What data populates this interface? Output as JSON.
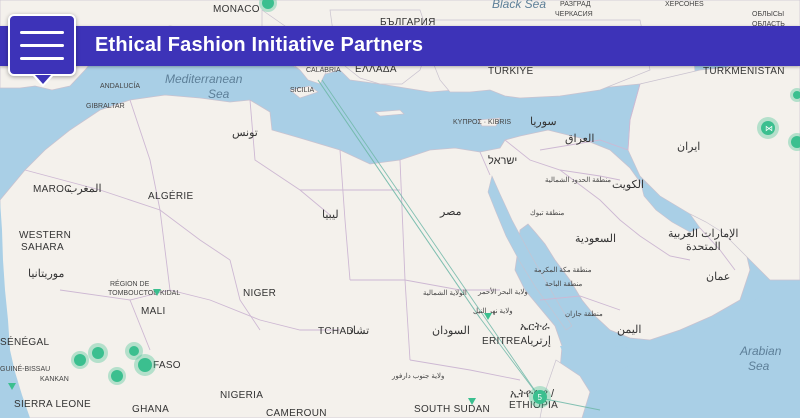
{
  "header": {
    "title": "Ethical Fashion Initiative Partners"
  },
  "map": {
    "land_color": "#f4f1ec",
    "water_color": "#a9cfe6",
    "marker_color": "#3bbf8f",
    "route_color": "#6fb8a8",
    "seas": {
      "black_sea": "Black Sea",
      "mediterranean": "Mediterranean",
      "sea": "Sea",
      "arabian": "Arabian",
      "sea2": "Sea"
    },
    "countries": {
      "monaco": "MONACO",
      "bulgaria": "БЪЛГАРИЯ",
      "greece": "ΕΛΛΑΔΑ",
      "turkey": "TÜRKİYE",
      "turkmenistan": "TURKMENISTAN",
      "gibraltar": "GIBRALTAR",
      "andalucia": "ANDALUCÍA",
      "sicilia": "SICILIA",
      "calabria": "CALABRIA",
      "tunisia": "تونس",
      "cyprus": "ΚΥΠΡΟΣ · KIBRIS",
      "syria": "سوريا",
      "iraq": "العراق",
      "iran": "ایران",
      "israel": "ישראל",
      "morocco_fr": "MAROC",
      "morocco_ar": "المغرب",
      "algeria": "ALGÉRIE",
      "libya": "ليبيا",
      "egypt": "مصر",
      "kuwait": "الكويت",
      "saudi": "السعودية",
      "uae_1": "الإمارات العربية",
      "uae_2": "المتحدة",
      "oman": "عمان",
      "western_sahara_1": "WESTERN",
      "western_sahara_2": "SAHARA",
      "mauritania": "موريتانيا",
      "mali": "MALI",
      "niger": "NIGER",
      "chad_fr": "TCHAD",
      "chad_ar": "تشاد",
      "sudan": "السودان",
      "eritrea_1": "ኤርትራ",
      "eritrea_2": "ERITREA",
      "eritrea_3": "إرتريا",
      "yemen": "اليمن",
      "senegal": "SÉNÉGAL",
      "guinea_bissau": "GUINÉ-BISSAU",
      "faso": "FASO",
      "nigeria": "NIGERIA",
      "sierra_leone": "SIERRA LEONE",
      "ghana": "GHANA",
      "cameroun": "CAMEROUN",
      "south_sudan": "SOUTH SUDAN",
      "ethiopia_1": "ኢትዮጵያ /",
      "ethiopia_2": "ETHIOPIA",
      "kankan": "KANKAN",
      "timbuktu_1": "RÉGION DE",
      "timbuktu_2": "TOMBOUCTOU",
      "kidal": "KIDAL",
      "north_borders": "منطقة الحدود الشمالية",
      "tabuk": "منطقة تبوك",
      "makkah": "منطقة مكة المكرمة",
      "baha": "منطقة الباحة",
      "jazan": "منطقة جازان",
      "northern_state": "الولاية الشمالية",
      "red_sea_state": "ولاية البحر الأحمر",
      "nile_state": "ولاية نهر النيل",
      "south_darfur": "ولاية جنوب دارفور",
      "russia_region": "ОБЛЫСЫ",
      "kz_region": "ОБЛАСТЬ",
      "bg_1": "РАЗГРАД",
      "bg_2": "ЧЕРКАСИЯ",
      "ukr_1": "ХЕРСОНЕЅ"
    },
    "markers": [
      {
        "label": "",
        "cluster": true
      },
      {
        "label": "",
        "cluster": true
      },
      {
        "label": "",
        "cluster": true
      },
      {
        "label": "",
        "cluster": true
      },
      {
        "label": "",
        "cluster": true
      },
      {
        "label": "",
        "cluster": true
      },
      {
        "label": "",
        "cluster": true
      },
      {
        "label": "5",
        "cluster": true
      }
    ]
  }
}
